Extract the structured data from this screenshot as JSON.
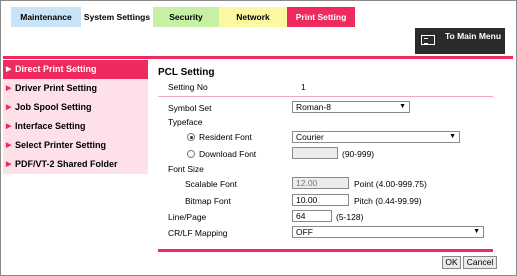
{
  "tabs": {
    "maintenance": "Maintenance",
    "system_settings": "System Settings",
    "security": "Security",
    "network": "Network",
    "print_setting": "Print Setting"
  },
  "main_menu": {
    "label": "To Main Menu",
    "icon": "menu-icon"
  },
  "sidebar": {
    "items": [
      {
        "label": "Direct Print Setting",
        "active": true
      },
      {
        "label": "Driver Print Setting",
        "active": false
      },
      {
        "label": "Job Spool Setting",
        "active": false
      },
      {
        "label": "Interface Setting",
        "active": false
      },
      {
        "label": "Select Printer Setting",
        "active": false
      },
      {
        "label": "PDF/VT-2 Shared Folder",
        "active": false
      }
    ]
  },
  "content": {
    "title": "PCL Setting",
    "setting_no": {
      "label": "Setting No",
      "value": "1"
    },
    "symbol_set": {
      "label": "Symbol Set",
      "value": "Roman-8"
    },
    "typeface": {
      "label": "Typeface",
      "resident_label": "Resident Font",
      "resident_value": "Courier",
      "download_label": "Download Font",
      "download_value": "",
      "download_range": "(90-999)"
    },
    "font_size": {
      "label": "Font Size",
      "scalable_label": "Scalable Font",
      "scalable_value": "12.00",
      "scalable_hint": "Point (4.00-999.75)",
      "bitmap_label": "Bitmap Font",
      "bitmap_value": "10.00",
      "bitmap_hint": "Pitch (0.44-99.99)"
    },
    "line_page": {
      "label": "Line/Page",
      "value": "64",
      "range": "(5-128)"
    },
    "crlf": {
      "label": "CR/LF Mapping",
      "value": "OFF"
    }
  },
  "buttons": {
    "ok": "OK",
    "cancel": "Cancel"
  },
  "colors": {
    "accent": "#ee2a5e",
    "sidebar_bg": "#fde0e8"
  }
}
